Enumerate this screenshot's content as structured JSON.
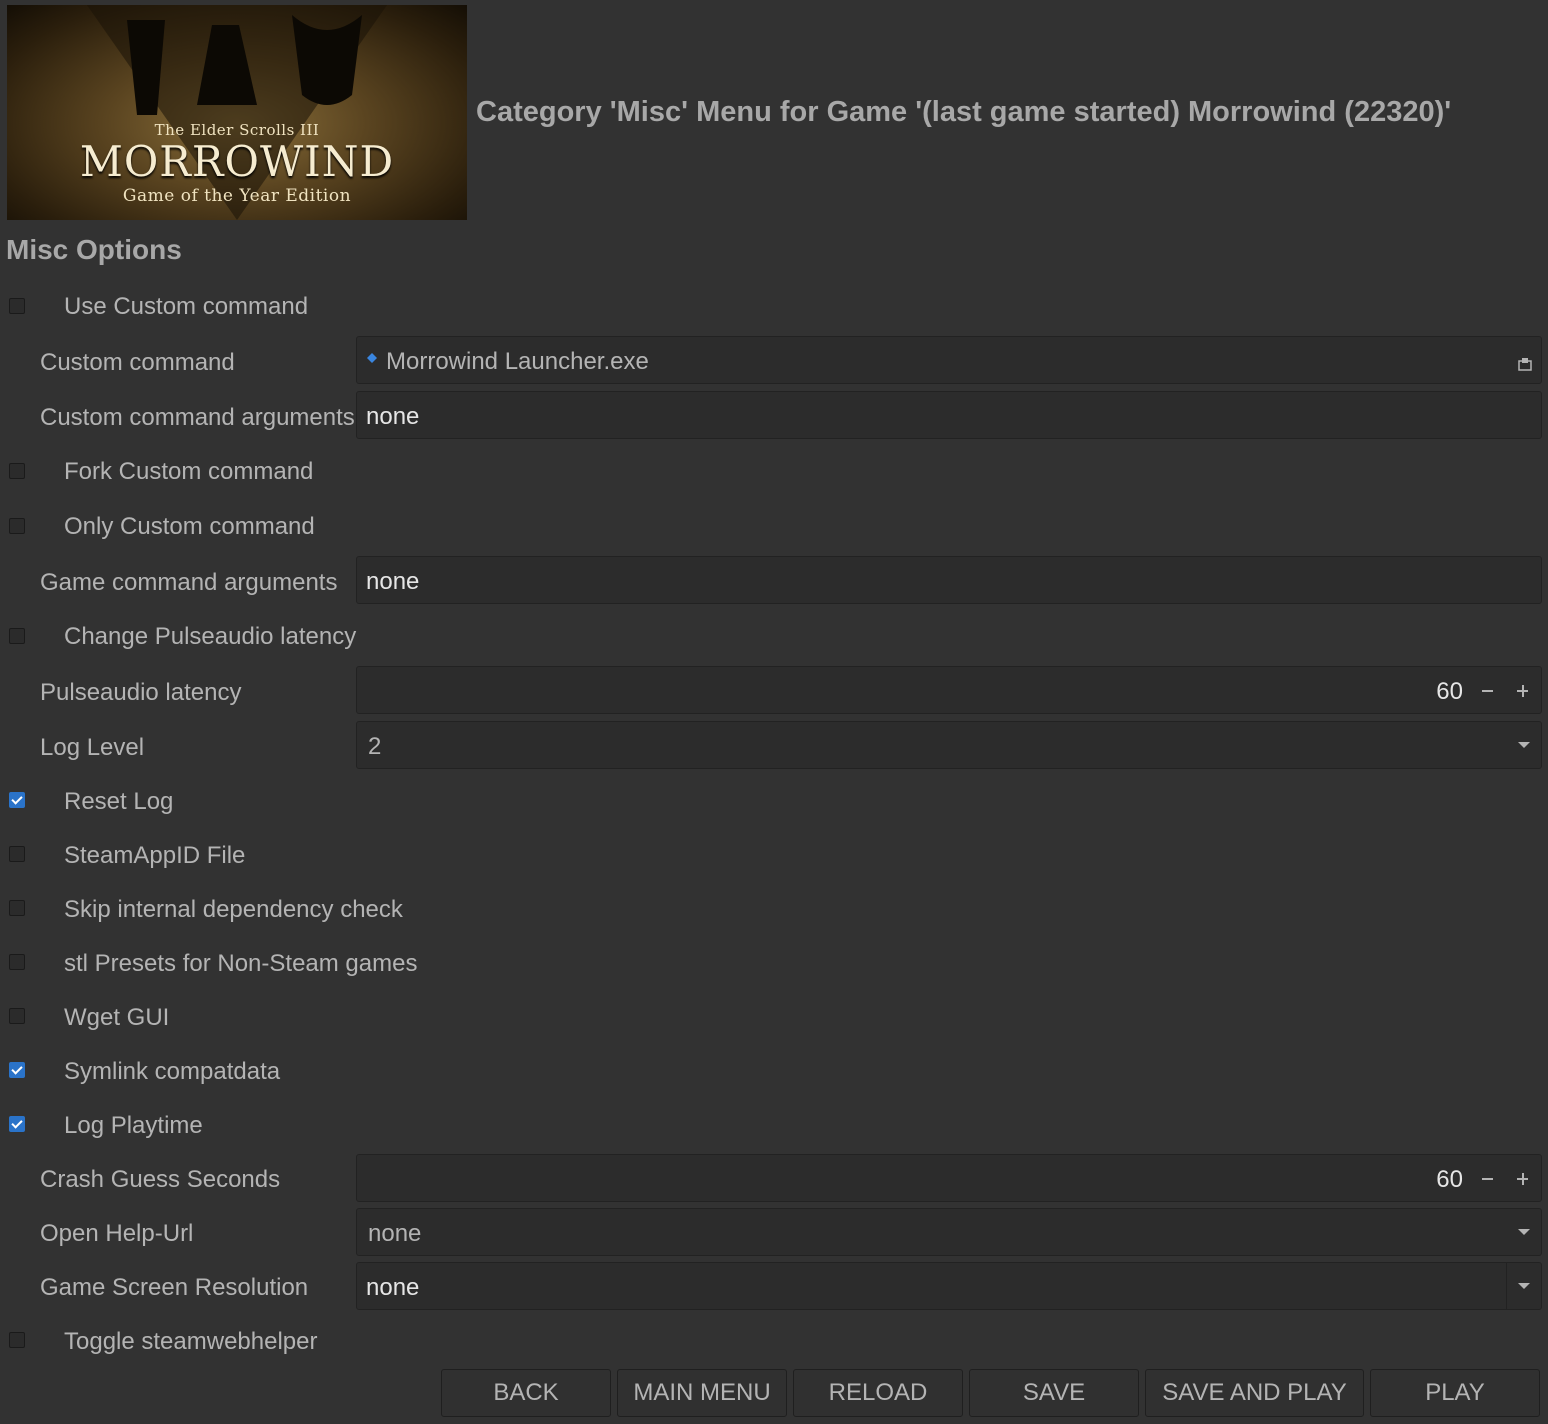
{
  "banner": {
    "top_text": "The Elder Scrolls III",
    "main_text": "MORROWIND",
    "sub_text": "Game of the Year Edition"
  },
  "title": "Category 'Misc' Menu for Game '(last game started) Morrowind (22320)'",
  "section": "Misc Options",
  "options": {
    "use_custom_command": {
      "label": "Use Custom command",
      "checked": false
    },
    "custom_command": {
      "label": "Custom command",
      "value": "Morrowind Launcher.exe",
      "icon": "save-icon"
    },
    "custom_command_arguments": {
      "label": "Custom command arguments",
      "value": "none"
    },
    "fork_custom_command": {
      "label": "Fork Custom command",
      "checked": false
    },
    "only_custom_command": {
      "label": "Only Custom command",
      "checked": false
    },
    "game_command_arguments": {
      "label": "Game command arguments",
      "value": "none"
    },
    "change_pulseaudio_latency": {
      "label": "Change Pulseaudio latency",
      "checked": false
    },
    "pulseaudio_latency": {
      "label": "Pulseaudio latency",
      "value": "60"
    },
    "log_level": {
      "label": "Log Level",
      "value": "2"
    },
    "reset_log": {
      "label": "Reset Log",
      "checked": true
    },
    "steamappid_file": {
      "label": "SteamAppID File",
      "checked": false
    },
    "skip_dependency_check": {
      "label": "Skip internal dependency check",
      "checked": false
    },
    "stl_presets": {
      "label": "stl Presets for Non-Steam games",
      "checked": false
    },
    "wget_gui": {
      "label": "Wget GUI",
      "checked": false
    },
    "symlink_compatdata": {
      "label": "Symlink compatdata",
      "checked": true
    },
    "log_playtime": {
      "label": "Log Playtime",
      "checked": true
    },
    "crash_guess_seconds": {
      "label": "Crash Guess Seconds",
      "value": "60"
    },
    "open_help_url": {
      "label": "Open Help-Url",
      "value": "none"
    },
    "game_screen_resolution": {
      "label": "Game Screen Resolution",
      "value": "none"
    },
    "toggle_steamwebhelper": {
      "label": "Toggle steamwebhelper",
      "checked": false
    }
  },
  "buttons": {
    "back": "BACK",
    "main_menu": "MAIN MENU",
    "reload": "RELOAD",
    "save": "SAVE",
    "save_and_play": "SAVE AND PLAY",
    "play": "PLAY"
  },
  "colors": {
    "background": "#323232",
    "field": "#2c2c2c",
    "check_accent": "#2a73c9"
  }
}
